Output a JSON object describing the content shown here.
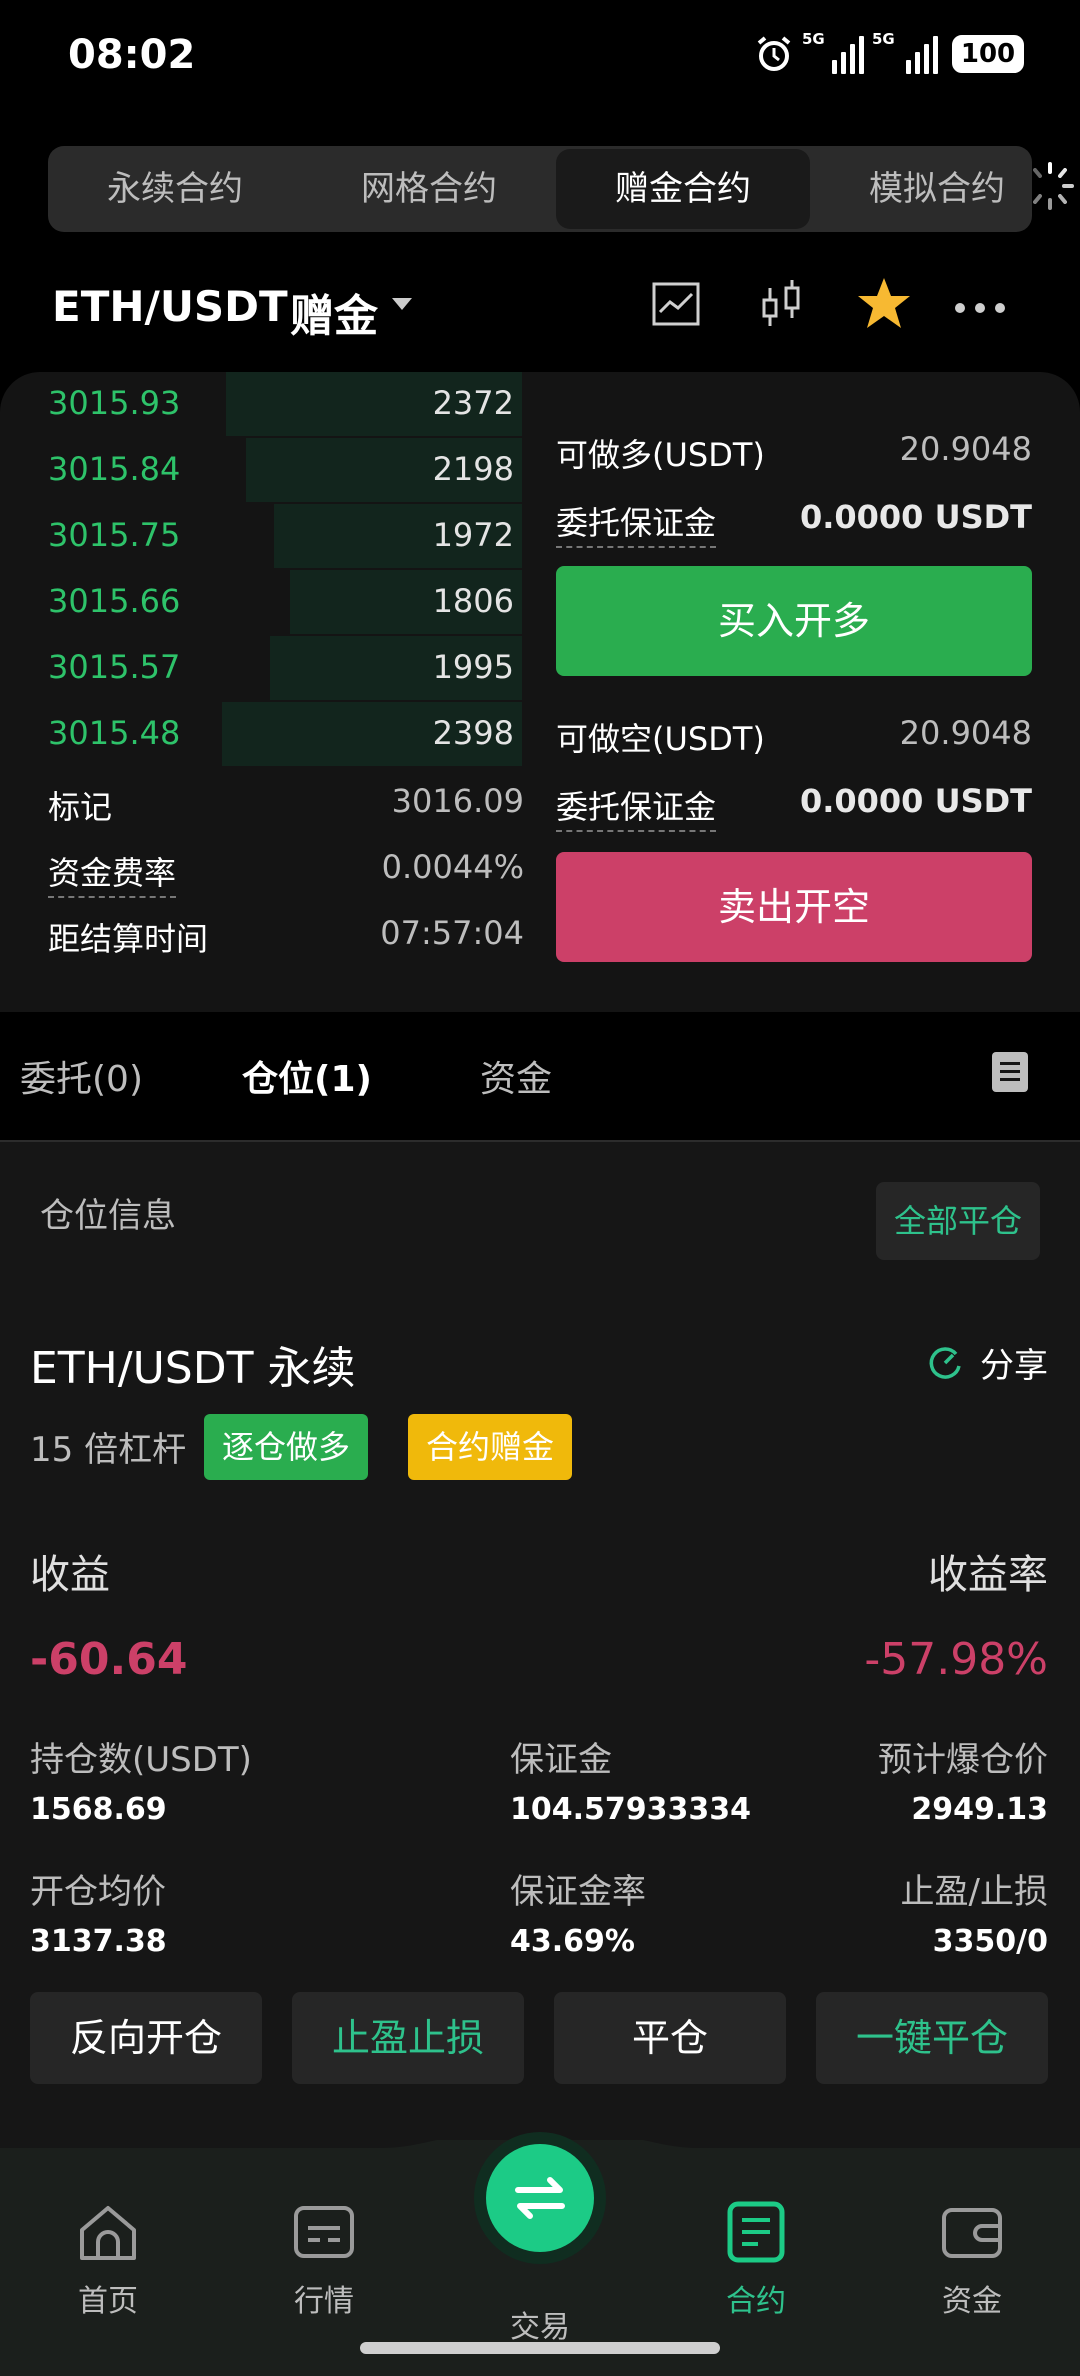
{
  "status_bar": {
    "time": "08:02",
    "network_1": "5G",
    "network_2": "5G",
    "battery": "100",
    "icons": [
      "alarm-icon",
      "signal-icon",
      "signal-icon",
      "battery-icon"
    ]
  },
  "top_tabs": [
    {
      "label": "永续合约",
      "active": false
    },
    {
      "label": "网格合约",
      "active": false
    },
    {
      "label": "赠金合约",
      "active": true
    },
    {
      "label": "模拟合约",
      "active": false
    }
  ],
  "header": {
    "pair": "ETH/USDT",
    "tag": "赠金",
    "icons": [
      "chart-icon",
      "candlestick-icon",
      "star-icon",
      "more-icon"
    ]
  },
  "order_book": [
    {
      "price": "3015.93",
      "qty": "2372",
      "depth": 0.74
    },
    {
      "price": "3015.84",
      "qty": "2198",
      "depth": 0.69
    },
    {
      "price": "3015.75",
      "qty": "1972",
      "depth": 0.62
    },
    {
      "price": "3015.66",
      "qty": "1806",
      "depth": 0.58
    },
    {
      "price": "3015.57",
      "qty": "1995",
      "depth": 0.63
    },
    {
      "price": "3015.48",
      "qty": "2398",
      "depth": 0.75
    }
  ],
  "market_info": [
    {
      "label": "标记",
      "value": "3016.09",
      "dotted": false
    },
    {
      "label": "资金费率",
      "value": "0.0044%",
      "dotted": true
    },
    {
      "label": "距结算时间",
      "value": "07:57:04",
      "dotted": false
    }
  ],
  "trade_panel": {
    "long_available_label": "可做多(USDT)",
    "long_available": "20.9048",
    "margin_label": "委托保证金",
    "long_margin": "0.0000 USDT",
    "buy_button": "买入开多",
    "short_available_label": "可做空(USDT)",
    "short_available": "20.9048",
    "short_margin": "0.0000 USDT",
    "sell_button": "卖出开空"
  },
  "section_tabs": [
    {
      "label": "委托(0)",
      "active": false
    },
    {
      "label": "仓位(1)",
      "active": true
    },
    {
      "label": "资金",
      "active": false
    }
  ],
  "position": {
    "section_title": "仓位信息",
    "close_all": "全部平仓",
    "symbol": "ETH/USDT 永续",
    "share": "分享",
    "leverage": "15 倍杠杆",
    "badge_mode": "逐仓做多",
    "badge_bonus": "合约赠金",
    "pnl_label": "收益",
    "pnl": "-60.64",
    "roe_label": "收益率",
    "roe": "-57.98%",
    "size_label": "持仓数(USDT)",
    "size": "1568.69",
    "margin_label": "保证金",
    "margin": "104.57933334",
    "liq_label": "预计爆仓价",
    "liq": "2949.13",
    "entry_label": "开仓均价",
    "entry": "3137.38",
    "margin_ratio_label": "保证金率",
    "margin_ratio": "43.69%",
    "tpsl_label": "止盈/止损",
    "tpsl": "3350/0",
    "btn_reverse": "反向开仓",
    "btn_tpsl": "止盈止损",
    "btn_close": "平仓",
    "btn_close_all": "一键平仓"
  },
  "bottom_nav": [
    {
      "label": "首页",
      "icon": "home-icon",
      "active": false
    },
    {
      "label": "行情",
      "icon": "market-icon",
      "active": false
    },
    {
      "label": "交易",
      "icon": "swap-icon",
      "active": false
    },
    {
      "label": "合约",
      "icon": "contract-icon",
      "active": true
    },
    {
      "label": "资金",
      "icon": "wallet-icon",
      "active": false
    }
  ],
  "colors": {
    "green": "#2aad4f",
    "red": "#cc4068",
    "accent": "#1ccb86",
    "yellow": "#f0b90b"
  }
}
